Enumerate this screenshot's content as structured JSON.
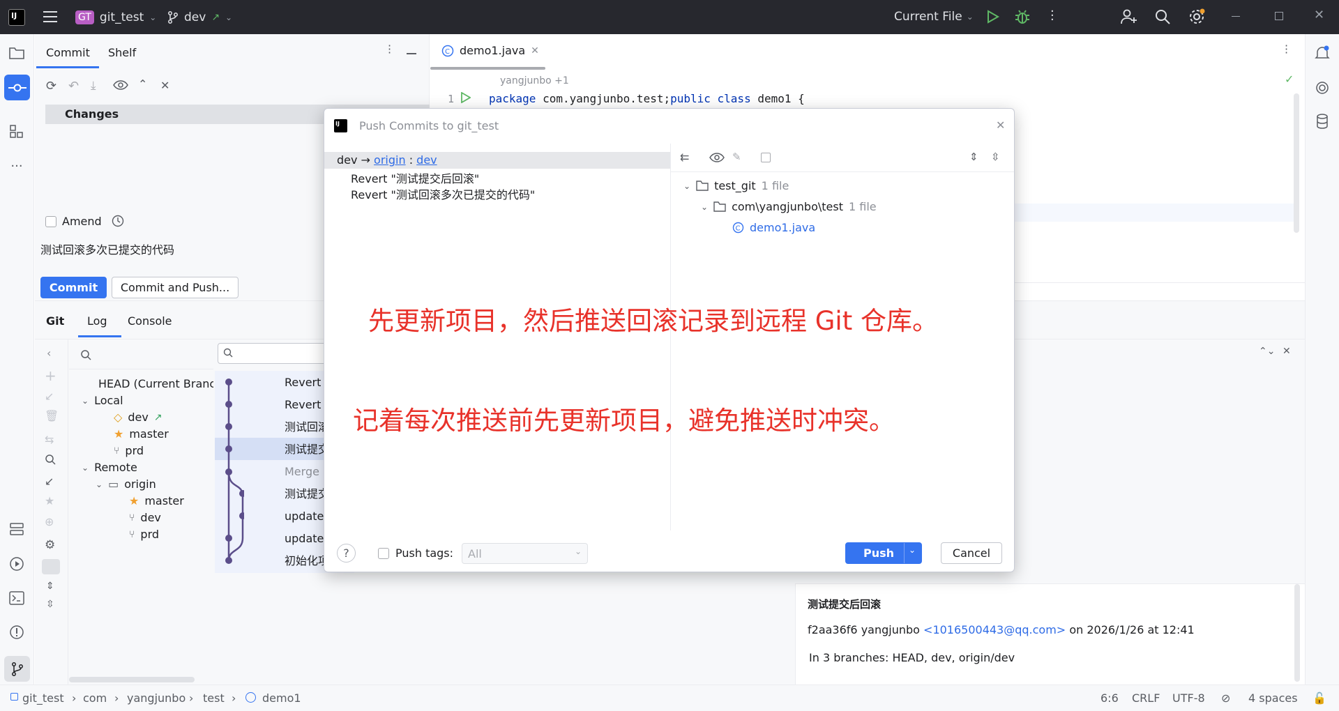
{
  "titlebar": {
    "project_badge": "GT",
    "project": "git_test",
    "branch": "dev",
    "run_config": "Current File"
  },
  "commit_panel": {
    "tabs": [
      "Commit",
      "Shelf"
    ],
    "changes_label": "Changes",
    "amend_label": "Amend",
    "message": "测试回滚多次已提交的代码",
    "commit_button": "Commit",
    "commit_push_button": "Commit and Push..."
  },
  "git_panel": {
    "tabs": [
      "Git",
      "Log",
      "Console"
    ],
    "branches": {
      "head": "HEAD (Current Branch)",
      "local_label": "Local",
      "local": [
        "dev",
        "master",
        "prd"
      ],
      "remote_label": "Remote",
      "origin": "origin",
      "remote": [
        "master",
        "dev",
        "prd"
      ]
    },
    "log_rows": [
      "Revert \"测试提交后回滚\"",
      "Revert \"测试回滚多次已提交的代码\"",
      "测试回滚多次已提交的代码",
      "测试提交后回滚",
      "Merge remote-tracking branch",
      "测试提交代码",
      "update com/yangjunbo",
      "update com/yangjunbo",
      "初始化项目"
    ],
    "details": {
      "subject": "测试提交后回滚",
      "hash": "f2aa36f6",
      "author": "yangjunbo",
      "email": "<1016500443@qq.com>",
      "date": "on 2026/1/26 at 12:41",
      "branches": "In 3 branches: HEAD, dev, origin/dev"
    }
  },
  "editor": {
    "tab": "demo1.java",
    "blame": "yangjunbo +1",
    "line_number": "1",
    "code": {
      "kw1": "package",
      "pkg": " com.yangjunbo.test;",
      "kw2": "public",
      "kw3": "class",
      "rest": " demo1 {"
    }
  },
  "dialog": {
    "title": "Push Commits to git_test",
    "branch_local": "dev",
    "remote": "origin",
    "remote_branch": "dev",
    "commits": [
      "Revert \"测试提交后回滚\"",
      "Revert \"测试回滚多次已提交的代码\""
    ],
    "tree": {
      "root": "test_git",
      "root_count": "1 file",
      "folder": "com\\yangjunbo\\test",
      "folder_count": "1 file",
      "file": "demo1.java"
    },
    "push_tags_label": "Push tags:",
    "tags_select": "All",
    "push_button": "Push",
    "cancel_button": "Cancel"
  },
  "annotations": {
    "line1": "先更新项目，然后推送回滚记录到远程 Git 仓库。",
    "line2": "记着每次推送前先更新项目，避免推送时冲突。"
  },
  "statusbar": {
    "breadcrumb": [
      "git_test",
      "com",
      "yangjunbo",
      "test",
      "demo1"
    ],
    "position": "6:6",
    "line_sep": "CRLF",
    "encoding": "UTF-8",
    "indent": "4 spaces"
  },
  "colors": {
    "accent": "#3574f0",
    "annotation": "#e8322a",
    "titlebar": "#27282e",
    "graph_line": "#5b4e8a"
  }
}
